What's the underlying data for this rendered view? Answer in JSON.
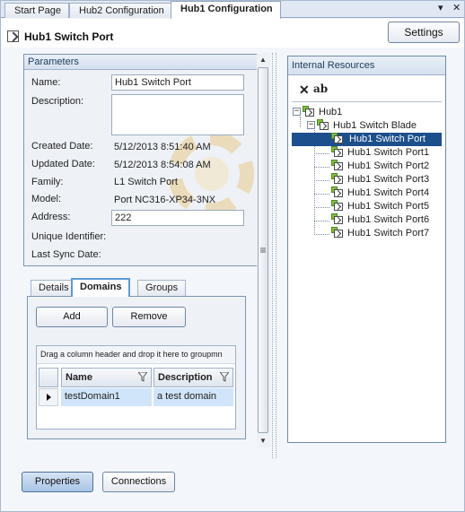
{
  "tabs": [
    {
      "label": "Start Page",
      "active": false
    },
    {
      "label": "Hub2 Configuration",
      "active": false
    },
    {
      "label": "Hub1 Configuration",
      "active": true
    }
  ],
  "tab_controls": {
    "menu": "▾",
    "close": "✕"
  },
  "header": {
    "title": "Hub1 Switch Port",
    "settings_label": "Settings"
  },
  "parameters": {
    "title": "Parameters",
    "name_label": "Name:",
    "name_value": "Hub1 Switch Port",
    "description_label": "Description:",
    "description_value": "",
    "created_label": "Created Date:",
    "created_value": "5/12/2013 8:51:40 AM",
    "updated_label": "Updated Date:",
    "updated_value": "5/12/2013 8:54:08 AM",
    "family_label": "Family:",
    "family_value": "L1 Switch Port",
    "model_label": "Model:",
    "model_value": "Port NC316-XP34-3NX",
    "address_label": "Address:",
    "address_value": "222",
    "uid_label": "Unique Identifier:",
    "sync_label": "Last Sync Date:"
  },
  "splitter_grip": "≡",
  "detail_tabs": [
    {
      "label": "Details",
      "active": false
    },
    {
      "label": "Domains",
      "active": true
    },
    {
      "label": "Groups",
      "active": false
    }
  ],
  "domains": {
    "add_label": "Add",
    "remove_label": "Remove",
    "group_hint": "Drag a column header and drop it here to groupmn",
    "columns": [
      "Name",
      "Description"
    ],
    "rows": [
      {
        "name": "testDomain1",
        "description": "a test domain"
      }
    ]
  },
  "resources": {
    "title": "Internal Resources",
    "delete_icon": "✕",
    "rename_icon": "ab",
    "tree": [
      {
        "label": "Hub1",
        "level": 0,
        "expanded": true,
        "selected": false
      },
      {
        "label": "Hub1 Switch Blade",
        "level": 1,
        "expanded": true,
        "selected": false
      },
      {
        "label": "Hub1 Switch Port",
        "level": 2,
        "selected": true
      },
      {
        "label": "Hub1 Switch Port1",
        "level": 2,
        "selected": false
      },
      {
        "label": "Hub1 Switch Port2",
        "level": 2,
        "selected": false
      },
      {
        "label": "Hub1 Switch Port3",
        "level": 2,
        "selected": false
      },
      {
        "label": "Hub1 Switch Port4",
        "level": 2,
        "selected": false
      },
      {
        "label": "Hub1 Switch Port5",
        "level": 2,
        "selected": false
      },
      {
        "label": "Hub1 Switch Port6",
        "level": 2,
        "selected": false
      },
      {
        "label": "Hub1 Switch Port7",
        "level": 2,
        "selected": false
      }
    ],
    "expander_minus": "−"
  },
  "bottom": {
    "properties_label": "Properties",
    "connections_label": "Connections"
  },
  "colors": {
    "selection": "#1c4f8c",
    "row_selected": "#d0e5f9",
    "panel_border": "#7d95b5"
  }
}
